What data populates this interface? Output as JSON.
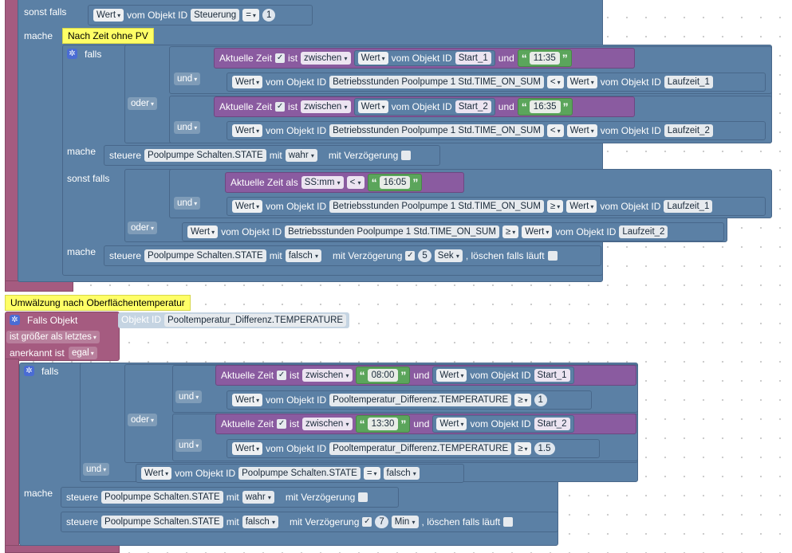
{
  "colors": {
    "logic": "#5b80a5",
    "time": "#8a5ba0",
    "text": "#5ba55b",
    "event": "#a55b80",
    "comment": "#ffff66"
  },
  "top": {
    "sonst_falls": "sonst falls",
    "mache": "mache",
    "comment": "Nach Zeit ohne PV",
    "cond": {
      "prop": "Wert",
      "vom": "vom Objekt ID",
      "obj": "Steuerung",
      "op": "=",
      "val": "1"
    }
  },
  "block1": {
    "falls": "falls",
    "und1": "und",
    "oder": "oder",
    "und2": "und",
    "mache": "mache",
    "sonst_falls": "sonst falls",
    "und3": "und",
    "oder2": "oder",
    "mache2": "mache",
    "time1": {
      "label": "Aktuelle Zeit",
      "ist": "ist",
      "mode": "zwischen",
      "prop": "Wert",
      "vom": "vom Objekt ID",
      "obj": "Start_1",
      "und": "und",
      "str": "11:35"
    },
    "cmp1": {
      "prop": "Wert",
      "vom": "vom Objekt ID",
      "obj": "Betriebsstunden Poolpumpe  1 Std.TIME_ON_SUM",
      "op": "<",
      "prop2": "Wert",
      "vom2": "vom Objekt ID",
      "obj2": "Laufzeit_1"
    },
    "time2": {
      "label": "Aktuelle Zeit",
      "ist": "ist",
      "mode": "zwischen",
      "prop": "Wert",
      "vom": "vom Objekt ID",
      "obj": "Start_2",
      "und": "und",
      "str": "16:35"
    },
    "cmp2": {
      "prop": "Wert",
      "vom": "vom Objekt ID",
      "obj": "Betriebsstunden Poolpumpe  1 Std.TIME_ON_SUM",
      "op": "<",
      "prop2": "Wert",
      "vom2": "vom Objekt ID",
      "obj2": "Laufzeit_2"
    },
    "set1": {
      "steuere": "steuere",
      "obj": "Poolpumpe Schalten.STATE",
      "mit": "mit",
      "val": "wahr",
      "delay": "mit Verzögerung"
    },
    "time3": {
      "label": "Aktuelle Zeit als",
      "fmt": "SS:mm",
      "op": "<",
      "str": "16:05"
    },
    "cmp3": {
      "prop": "Wert",
      "vom": "vom Objekt ID",
      "obj": "Betriebsstunden Poolpumpe  1 Std.TIME_ON_SUM",
      "op": "≥",
      "prop2": "Wert",
      "vom2": "vom Objekt ID",
      "obj2": "Laufzeit_1"
    },
    "cmp4": {
      "prop": "Wert",
      "vom": "vom Objekt ID",
      "obj": "Betriebsstunden Poolpumpe  1 Std.TIME_ON_SUM",
      "op": "≥",
      "prop2": "Wert",
      "vom2": "vom Objekt ID",
      "obj2": "Laufzeit_2"
    },
    "set2": {
      "steuere": "steuere",
      "obj": "Poolpumpe Schalten.STATE",
      "mit": "mit",
      "val": "falsch",
      "delay": "mit Verzögerung",
      "n": "5",
      "unit": "Sek",
      "clear": ", löschen falls läuft"
    }
  },
  "event": {
    "comment": "Umwälzung nach Oberflächentemperatur",
    "falls_objekt": "Falls Objekt",
    "objekt_id": "Objekt ID",
    "obj": "Pooltemperatur_Differenz.TEMPERATURE",
    "trigger": "ist größer als letztes",
    "anerkannt": "anerkannt ist",
    "egal": "egal",
    "falls": "falls",
    "und1": "und",
    "oder": "oder",
    "und2": "und",
    "und3": "und",
    "mache": "mache",
    "time1": {
      "label": "Aktuelle Zeit",
      "ist": "ist",
      "mode": "zwischen",
      "str": "08:00",
      "und": "und",
      "prop": "Wert",
      "vom": "vom Objekt ID",
      "obj": "Start_1"
    },
    "cmp1": {
      "prop": "Wert",
      "vom": "vom Objekt ID",
      "obj": "Pooltemperatur_Differenz.TEMPERATURE",
      "op": "≥",
      "val": "1"
    },
    "time2": {
      "label": "Aktuelle Zeit",
      "ist": "ist",
      "mode": "zwischen",
      "str": "13:30",
      "und": "und",
      "prop": "Wert",
      "vom": "vom Objekt ID",
      "obj": "Start_2"
    },
    "cmp2": {
      "prop": "Wert",
      "vom": "vom Objekt ID",
      "obj": "Pooltemperatur_Differenz.TEMPERATURE",
      "op": "≥",
      "val": "1.5"
    },
    "cmp3": {
      "prop": "Wert",
      "vom": "vom Objekt ID",
      "obj": "Poolpumpe Schalten.STATE",
      "op": "=",
      "val": "falsch"
    },
    "set1": {
      "steuere": "steuere",
      "obj": "Poolpumpe Schalten.STATE",
      "mit": "mit",
      "val": "wahr",
      "delay": "mit Verzögerung"
    },
    "set2": {
      "steuere": "steuere",
      "obj": "Poolpumpe Schalten.STATE",
      "mit": "mit",
      "val": "falsch",
      "delay": "mit Verzögerung",
      "n": "7",
      "unit": "Min",
      "clear": ", löschen falls läuft"
    }
  }
}
